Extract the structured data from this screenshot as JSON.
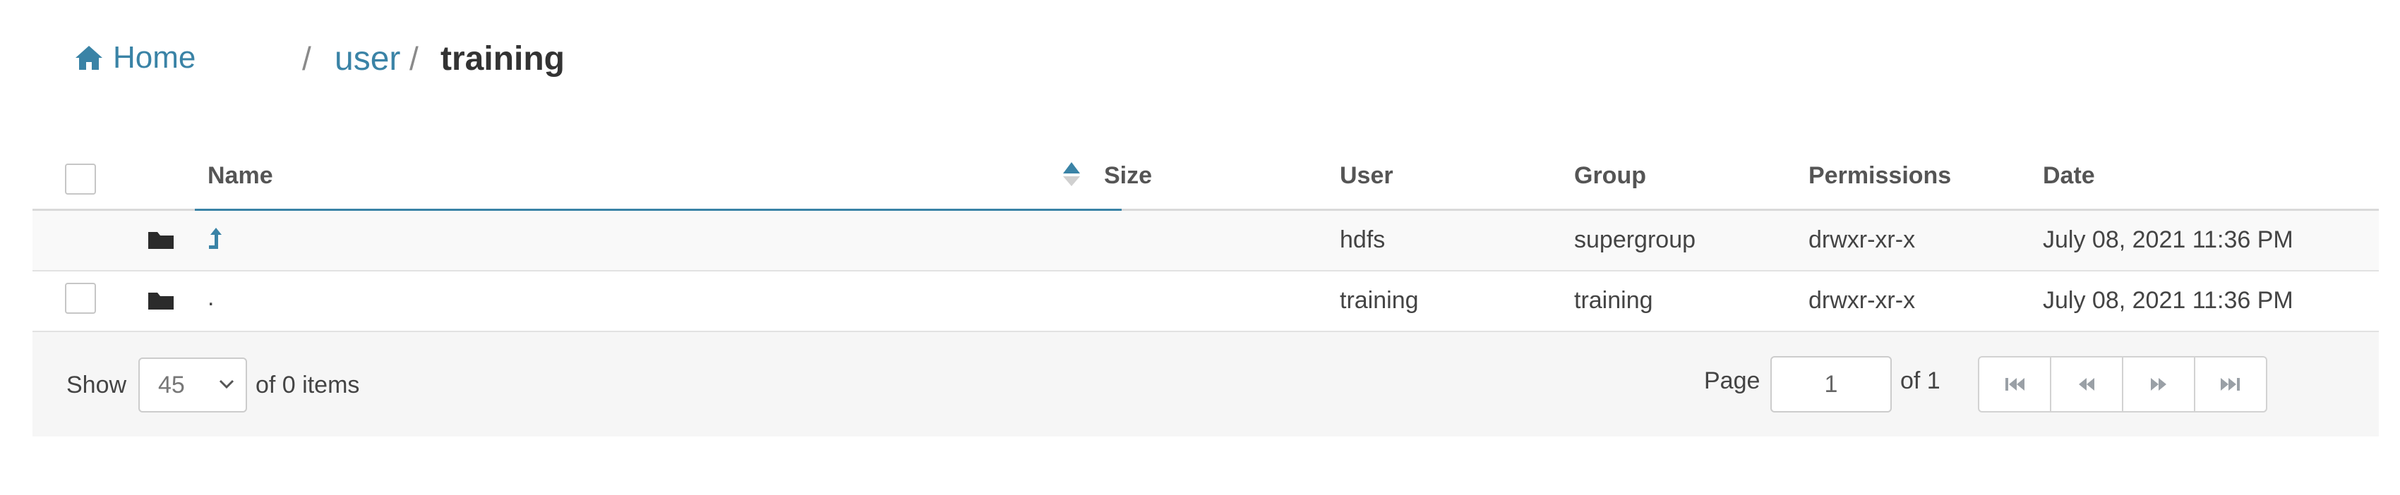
{
  "breadcrumb": {
    "home_label": "Home",
    "separator": "/",
    "path": [
      "user"
    ],
    "current": "training"
  },
  "table": {
    "columns": {
      "name": "Name",
      "size": "Size",
      "user": "User",
      "group": "Group",
      "permissions": "Permissions",
      "date": "Date"
    },
    "sort": {
      "column": "Name",
      "direction": "ascending"
    },
    "rows": [
      {
        "name": "",
        "name_icon": "arrow-up-icon",
        "size": "",
        "user": "hdfs",
        "group": "supergroup",
        "permissions": "drwxr-xr-x",
        "date": "July 08, 2021 11:36 PM"
      },
      {
        "name": ".",
        "size": "",
        "user": "training",
        "group": "training",
        "permissions": "drwxr-xr-x",
        "date": "July 08, 2021 11:36 PM"
      }
    ]
  },
  "footer": {
    "show_label": "Show",
    "page_size": "45",
    "items_label": "of 0 items",
    "page_label": "Page",
    "page_value": "1",
    "of_pages": "of 1"
  },
  "colors": {
    "link": "#3a83a6",
    "header_underline": "#3a83a6",
    "footer_bg": "#f6f6f6"
  },
  "icons": {
    "home": "home-icon",
    "folder": "folder-icon",
    "parent": "arrow-up-icon",
    "sort": "sort-ascending-icon",
    "first": "first-page-icon",
    "prev": "previous-page-icon",
    "next": "next-page-icon",
    "last": "last-page-icon"
  }
}
